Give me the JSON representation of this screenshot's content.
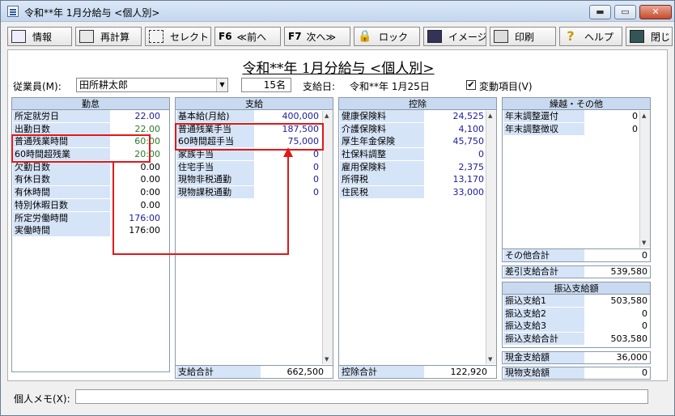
{
  "window": {
    "title": "令和**年 1月分給与 <個人別>",
    "min": "▬",
    "max": "▭",
    "close": "✕"
  },
  "toolbar": [
    {
      "key": "",
      "label": "情報",
      "icon": "book-icon"
    },
    {
      "key": "",
      "label": "再計算",
      "icon": "calculator-icon"
    },
    {
      "key": "",
      "label": "セレクト",
      "icon": "select-icon"
    },
    {
      "key": "F6",
      "label": "≪前へ",
      "icon": ""
    },
    {
      "key": "F7",
      "label": "次へ≫",
      "icon": ""
    },
    {
      "key": "",
      "label": "ロック",
      "icon": "lock-icon"
    },
    {
      "key": "",
      "label": "イメージ",
      "icon": "monitor-icon"
    },
    {
      "key": "",
      "label": "印刷",
      "icon": "printer-icon"
    },
    {
      "key": "",
      "label": "ヘルプ",
      "icon": "help-icon"
    },
    {
      "key": "",
      "label": "閉じ",
      "icon": "exit-icon"
    }
  ],
  "page_title": "令和**年 1月分給与 <個人別>",
  "employee": {
    "label": "従業員(M):",
    "name": "田所耕太郎",
    "count": "15名",
    "paydate_label": "支給日:",
    "paydate": "令和**年 1月25日",
    "check_mark": "✔",
    "variable_label": "変動項目(V)"
  },
  "kintai": {
    "title": "勤怠",
    "rows": [
      {
        "label": "所定就労日",
        "value": "22.00",
        "color": "blue"
      },
      {
        "label": "出勤日数",
        "value": "22.00",
        "color": "green"
      },
      {
        "label": "普通残業時間",
        "value": "60:00",
        "color": "green"
      },
      {
        "label": "60時間超残業",
        "value": "20:00",
        "color": "green"
      },
      {
        "label": "欠勤日数",
        "value": "0.00",
        "color": "black"
      },
      {
        "label": "有休日数",
        "value": "0.00",
        "color": "black"
      },
      {
        "label": "有休時間",
        "value": "0:00",
        "color": "black"
      },
      {
        "label": "特別休暇日数",
        "value": "0.00",
        "color": "black"
      },
      {
        "label": "所定労働時間",
        "value": "176:00",
        "color": "blue"
      },
      {
        "label": "実働時間",
        "value": "176:00",
        "color": "black"
      }
    ]
  },
  "shikyu": {
    "title": "支給",
    "rows": [
      {
        "label": "基本給(月給)",
        "value": "400,000"
      },
      {
        "label": "普通残業手当",
        "value": "187,500"
      },
      {
        "label": "60時間超手当",
        "value": "75,000"
      },
      {
        "label": "家族手当",
        "value": "0"
      },
      {
        "label": "住宅手当",
        "value": "0"
      },
      {
        "label": "現物非税通勤",
        "value": "0"
      },
      {
        "label": "現物課税通勤",
        "value": "0"
      }
    ],
    "total_label": "支給合計",
    "total": "662,500"
  },
  "kojo": {
    "title": "控除",
    "rows": [
      {
        "label": "健康保険料",
        "value": "24,525"
      },
      {
        "label": "介護保険料",
        "value": "4,100"
      },
      {
        "label": "厚生年金保険",
        "value": "45,750"
      },
      {
        "label": "社保料調整",
        "value": "0"
      },
      {
        "label": "雇用保険料",
        "value": "2,375"
      },
      {
        "label": "所得税",
        "value": "13,170"
      },
      {
        "label": "住民税",
        "value": "33,000"
      }
    ],
    "total_label": "控除合計",
    "total": "122,920"
  },
  "kurikoshi": {
    "title": "繰越・その他",
    "rows": [
      {
        "label": "年末調整還付",
        "value": "0"
      },
      {
        "label": "年末調整徴収",
        "value": "0"
      }
    ],
    "other_label": "その他合計",
    "other": "0"
  },
  "sashihiki": {
    "label": "差引支給合計",
    "value": "539,580"
  },
  "furikomi": {
    "title": "振込支給額",
    "rows": [
      {
        "label": "振込支給1",
        "value": "503,580"
      },
      {
        "label": "振込支給2",
        "value": "0"
      },
      {
        "label": "振込支給3",
        "value": "0"
      },
      {
        "label": "振込支給合計",
        "value": "503,580"
      }
    ]
  },
  "genkin": {
    "label": "現金支給額",
    "value": "36,000"
  },
  "genbutsu": {
    "label": "現物支給額",
    "value": "0"
  },
  "memo": {
    "label": "個人メモ(X):",
    "value": ""
  }
}
